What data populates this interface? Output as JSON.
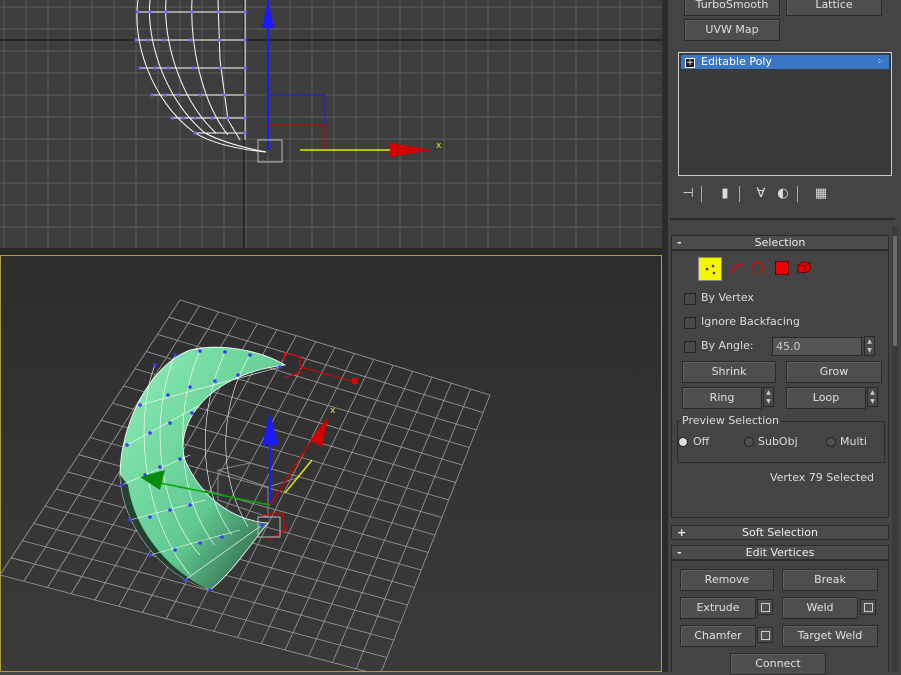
{
  "modifier_buttons": {
    "turbosmooth": "TurboSmooth",
    "lattice": "Lattice",
    "uvw_map": "UVW Map"
  },
  "stack": {
    "selected_item": "Editable Poly"
  },
  "selection": {
    "title": "Selection",
    "by_vertex": "By Vertex",
    "ignore_backfacing": "Ignore Backfacing",
    "by_angle": "By Angle:",
    "angle_value": "45.0",
    "shrink": "Shrink",
    "grow": "Grow",
    "ring": "Ring",
    "loop": "Loop",
    "preview_title": "Preview Selection",
    "preview_off": "Off",
    "preview_subobj": "SubObj",
    "preview_multi": "Multi",
    "status": "Vertex 79 Selected"
  },
  "soft_selection": {
    "title": "Soft Selection",
    "toggle": "+"
  },
  "edit_vertices": {
    "title": "Edit Vertices",
    "toggle": "-",
    "remove": "Remove",
    "break": "Break",
    "extrude": "Extrude",
    "weld": "Weld",
    "chamfer": "Chamfer",
    "target_weld": "Target Weld",
    "connect": "Connect"
  },
  "selection_toggle": "-",
  "viewport": {
    "axis_x": "x"
  },
  "colors": {
    "stack_highlight": "#3a78c6",
    "vertex_mode_active": "#f5f500",
    "mesh_face": "#6ed8a0",
    "viewport_border": "#b39a3a"
  }
}
